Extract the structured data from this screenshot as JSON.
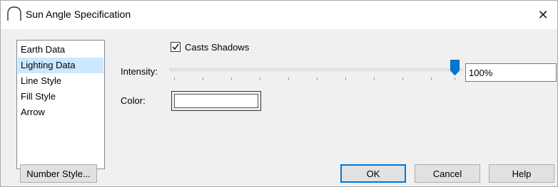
{
  "window": {
    "title": "Sun Angle Specification",
    "close_glyph": "✕",
    "title_icon": "sun-angle-arc-icon"
  },
  "sidebar": {
    "items": [
      {
        "label": "Earth Data",
        "selected": false
      },
      {
        "label": "Lighting Data",
        "selected": true
      },
      {
        "label": "Line Style",
        "selected": false
      },
      {
        "label": "Fill Style",
        "selected": false
      },
      {
        "label": "Arrow",
        "selected": false
      }
    ]
  },
  "lighting": {
    "casts_shadows_label": "Casts Shadows",
    "casts_shadows_checked": true,
    "intensity_label": "Intensity:",
    "intensity_value": "100%",
    "intensity_fraction": 1.0,
    "color_label": "Color:",
    "color_value": "#ffffff"
  },
  "buttons": {
    "number_style": "Number Style...",
    "ok": "OK",
    "cancel": "Cancel",
    "help": "Help"
  },
  "colors": {
    "selection": "#cce8ff",
    "accent": "#0078d7"
  }
}
